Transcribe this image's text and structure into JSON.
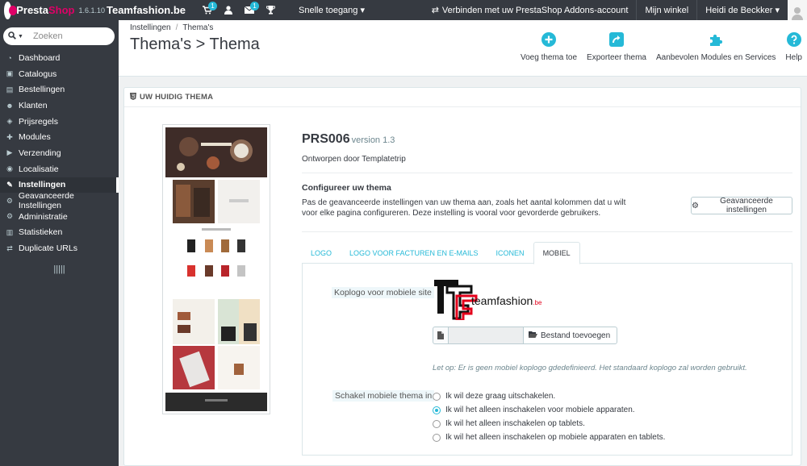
{
  "topbar": {
    "brand_part1": "Presta",
    "brand_part2": "Shop",
    "version": "1.6.1.10",
    "shop_name": "Teamfashion.be",
    "cart_badge": "1",
    "mail_badge": "1",
    "quick_access": "Snelle toegang",
    "addons_link": "Verbinden met uw PrestaShop Addons-account",
    "my_shop": "Mijn winkel",
    "user": "Heidi de Beckker"
  },
  "sidebar": {
    "search_placeholder": "Zoeken",
    "items": [
      {
        "label": "Dashboard",
        "icon": "dashboard-icon"
      },
      {
        "label": "Catalogus",
        "icon": "catalog-icon"
      },
      {
        "label": "Bestellingen",
        "icon": "orders-icon"
      },
      {
        "label": "Klanten",
        "icon": "customers-icon"
      },
      {
        "label": "Prijsregels",
        "icon": "price-rules-icon"
      },
      {
        "label": "Modules",
        "icon": "modules-icon"
      },
      {
        "label": "Verzending",
        "icon": "shipping-icon"
      },
      {
        "label": "Localisatie",
        "icon": "localization-icon"
      },
      {
        "label": "Instellingen",
        "icon": "settings-icon"
      },
      {
        "label": "Geavanceerde Instellingen",
        "icon": "advanced-settings-icon"
      },
      {
        "label": "Administratie",
        "icon": "administration-icon"
      },
      {
        "label": "Statistieken",
        "icon": "stats-icon"
      },
      {
        "label": "Duplicate URLs",
        "icon": "duplicate-urls-icon"
      }
    ],
    "active_index": 8
  },
  "header": {
    "breadcrumb": [
      "Instellingen",
      "Thema's"
    ],
    "title": "Thema's > Thema",
    "toolbar": [
      {
        "label": "Voeg thema toe",
        "icon": "add-circle-icon"
      },
      {
        "label": "Exporteer thema",
        "icon": "export-icon"
      },
      {
        "label": "Aanbevolen Modules en Services",
        "icon": "puzzle-icon"
      },
      {
        "label": "Help",
        "icon": "help-icon"
      }
    ]
  },
  "panel": {
    "heading": "UW HUIDIG THEMA",
    "theme_name": "PRS006",
    "theme_version": "version 1.3",
    "author": "Ontworpen door Templatetrip",
    "configure_title": "Configureer uw thema",
    "configure_desc": "Pas de geavanceerde instellingen van uw thema aan, zoals het aantal kolommen dat u wilt voor elke pagina configureren. Deze instelling is vooral voor gevorderde gebruikers.",
    "advanced_button": "Geavanceerde instellingen",
    "tabs": [
      "LOGO",
      "LOGO VOOR FACTUREN EN E-MAILS",
      "ICONEN",
      "MOBIEL"
    ],
    "active_tab": 3,
    "mobile": {
      "logo_label": "Koplogo voor mobiele site",
      "logo_text": "teamfashion",
      "logo_suffix": ".be",
      "file_button": "Bestand toevoegen",
      "note": "Let op: Er is geen mobiel koplogo gdedefinieerd. Het standaard koplogo zal worden gebruikt.",
      "switch_label": "Schakel mobiele thema in",
      "options": [
        "Ik wil deze graag uitschakelen.",
        "Ik wil het alleen inschakelen voor mobiele apparaten.",
        "Ik wil het alleen inschakelen op tablets.",
        "Ik wil het alleen inschakelen op mobiele apparaten en tablets."
      ],
      "selected_option": 1
    }
  },
  "colors": {
    "accent": "#25b9d7",
    "sidebar": "#363a41",
    "brand_pink": "#df0067",
    "logo_red": "#e3001b"
  }
}
